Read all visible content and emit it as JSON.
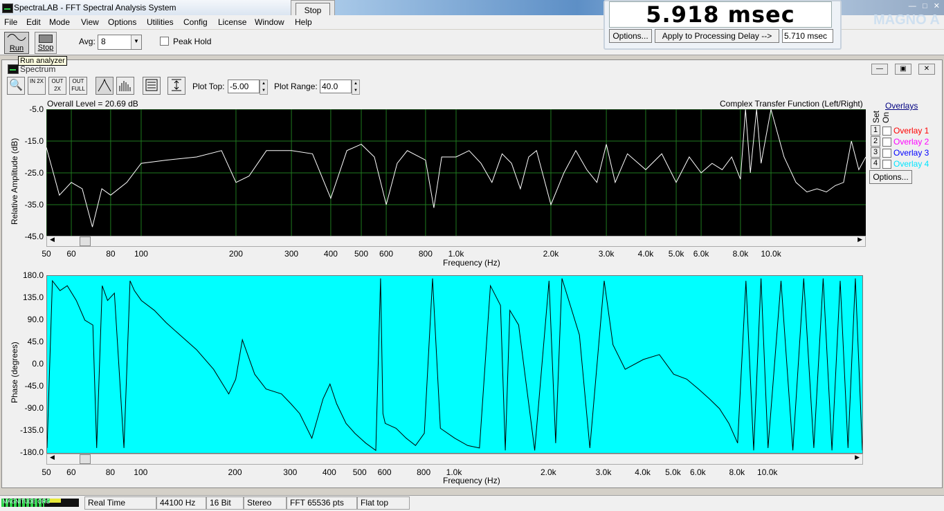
{
  "window": {
    "title": "SpectraLAB - FFT Spectral Analysis System"
  },
  "menu": [
    "File",
    "Edit",
    "Mode",
    "View",
    "Options",
    "Utilities",
    "Config",
    "License",
    "Window",
    "Help"
  ],
  "toolbar": {
    "run_label": "Run",
    "stop_label": "Stop",
    "avg_label": "Avg:",
    "avg_value": "8",
    "peak_hold_label": "Peak Hold",
    "tooltip": "Run analyzer"
  },
  "stop_popup": {
    "label": "Stop"
  },
  "delay_panel": {
    "value": "5.918 msec",
    "options_label": "Options...",
    "apply_label": "Apply to Processing Delay -->",
    "processing_delay": "5.710 msec"
  },
  "spectrum": {
    "title": "Spectrum",
    "icons": {
      "zoom": "magnifier-icon",
      "zoom_in": "IN 2X",
      "zoom_out": "OUT 2X",
      "zoom_full": "OUT FULL"
    },
    "plot_top_label": "Plot Top:",
    "plot_top_value": "-5.00",
    "plot_range_label": "Plot Range:",
    "plot_range_value": "40.0"
  },
  "overlays": {
    "header": "Overlays",
    "set_label": "Set",
    "on_label": "On",
    "items": [
      {
        "num": "1",
        "name": "Overlay 1",
        "color": "#ff0000"
      },
      {
        "num": "2",
        "name": "Overlay 2",
        "color": "#ff00ff"
      },
      {
        "num": "3",
        "name": "Overlay 3",
        "color": "#0000ff"
      },
      {
        "num": "4",
        "name": "Overlay 4",
        "color": "#00e5ff"
      }
    ],
    "options_label": "Options..."
  },
  "chart_data": [
    {
      "type": "line",
      "overall_level": "Overall Level = 20.69 dB",
      "title": "Complex Transfer Function (Left/Right)",
      "ylabel": "Relative Amplitude (dB)",
      "xlabel": "Frequency (Hz)",
      "x_scale": "log",
      "xlim": [
        50,
        20000
      ],
      "ylim": [
        -45,
        -5
      ],
      "y_ticks": [
        "-5.0",
        "-15.0",
        "-25.0",
        "-35.0",
        "-45.0"
      ],
      "x_ticks": [
        "50",
        "60",
        "80",
        "100",
        "200",
        "300",
        "400",
        "500",
        "600",
        "800",
        "1.0k",
        "2.0k",
        "3.0k",
        "4.0k",
        "5.0k",
        "6.0k",
        "8.0k",
        "10.0k"
      ],
      "background": "#000000",
      "line_color": "#ffffff",
      "grid_color": "#1f7a1f",
      "series": [
        {
          "x": [
            50,
            55,
            60,
            65,
            70,
            75,
            80,
            90,
            100,
            120,
            150,
            180,
            200,
            220,
            250,
            300,
            350,
            400,
            450,
            500,
            550,
            600,
            650,
            700,
            800,
            850,
            900,
            1000,
            1100,
            1200,
            1300,
            1400,
            1500,
            1600,
            1700,
            1800,
            2000,
            2200,
            2400,
            2600,
            2800,
            3000,
            3200,
            3500,
            4000,
            4500,
            5000,
            5500,
            6000,
            6500,
            7000,
            7500,
            8000,
            8300,
            8600,
            9000,
            9300,
            10000,
            11000,
            12000,
            13000,
            14000,
            15000,
            16000,
            17000,
            18000,
            19000,
            20000
          ],
          "y": [
            -17,
            -32,
            -28,
            -30,
            -42,
            -30,
            -32,
            -28,
            -22,
            -21,
            -20,
            -18,
            -28,
            -26,
            -18,
            -18,
            -19,
            -33,
            -18,
            -16,
            -20,
            -35,
            -22,
            -18,
            -21,
            -36,
            -20,
            -20,
            -18,
            -22,
            -28,
            -19,
            -22,
            -30,
            -20,
            -18,
            -35,
            -25,
            -18,
            -24,
            -28,
            -16,
            -28,
            -19,
            -24,
            -19,
            -28,
            -20,
            -25,
            -22,
            -24,
            -20,
            -27,
            -3,
            -25,
            -3,
            -22,
            -3,
            -20,
            -28,
            -31,
            -30,
            -31,
            -29,
            -28,
            -15,
            -24,
            -20
          ]
        }
      ]
    },
    {
      "type": "line",
      "ylabel": "Phase (degrees)",
      "xlabel": "Frequency (Hz)",
      "x_scale": "log",
      "xlim": [
        50,
        20000
      ],
      "ylim": [
        -180,
        180
      ],
      "y_ticks": [
        "180.0",
        "135.0",
        "90.0",
        "45.0",
        "0.0",
        "-45.0",
        "-90.0",
        "-135.0",
        "-180.0"
      ],
      "x_ticks": [
        "50",
        "60",
        "80",
        "100",
        "200",
        "300",
        "400",
        "500",
        "600",
        "800",
        "1.0k",
        "2.0k",
        "3.0k",
        "4.0k",
        "5.0k",
        "6.0k",
        "8.0k",
        "10.0k"
      ],
      "background": "#00ffff",
      "line_color": "#000000",
      "series": [
        {
          "x": [
            50,
            52,
            55,
            58,
            62,
            66,
            70,
            72,
            75,
            78,
            82,
            88,
            92,
            95,
            100,
            110,
            120,
            130,
            150,
            170,
            190,
            200,
            210,
            230,
            250,
            280,
            300,
            320,
            350,
            380,
            400,
            420,
            450,
            480,
            520,
            560,
            580,
            590,
            600,
            650,
            700,
            750,
            800,
            850,
            900,
            1000,
            1100,
            1200,
            1300,
            1400,
            1450,
            1500,
            1600,
            1800,
            2000,
            2100,
            2200,
            2500,
            2700,
            3000,
            3200,
            3500,
            4000,
            4500,
            5000,
            5500,
            6000,
            6500,
            7000,
            7500,
            8000,
            8500,
            9000,
            9500,
            10000,
            11000,
            12000,
            13000,
            14000,
            15000,
            16000,
            17000,
            18000,
            19000,
            20000
          ],
          "y": [
            -170,
            170,
            150,
            160,
            130,
            90,
            80,
            -170,
            160,
            130,
            145,
            -170,
            170,
            150,
            130,
            110,
            85,
            65,
            30,
            -10,
            -60,
            -30,
            50,
            -20,
            -50,
            -60,
            -80,
            -100,
            -150,
            -70,
            -40,
            -80,
            -120,
            -140,
            -160,
            -175,
            175,
            -100,
            -120,
            -130,
            -150,
            -165,
            -140,
            175,
            -130,
            -150,
            -165,
            -170,
            160,
            120,
            -175,
            110,
            80,
            -175,
            170,
            -160,
            175,
            60,
            -170,
            170,
            40,
            -10,
            10,
            20,
            -20,
            -30,
            -50,
            -70,
            -90,
            -120,
            -160,
            170,
            -175,
            175,
            -170,
            170,
            -175,
            175,
            -170,
            175,
            -175,
            170,
            -170,
            175,
            -175
          ]
        }
      ]
    }
  ],
  "status": {
    "meter_text": "MAGNITUDE ORG",
    "mode": "Real Time",
    "rate": "44100 Hz",
    "bits": "16 Bit",
    "channels": "Stereo",
    "fft": "FFT 65536 pts",
    "window": "Flat top"
  }
}
